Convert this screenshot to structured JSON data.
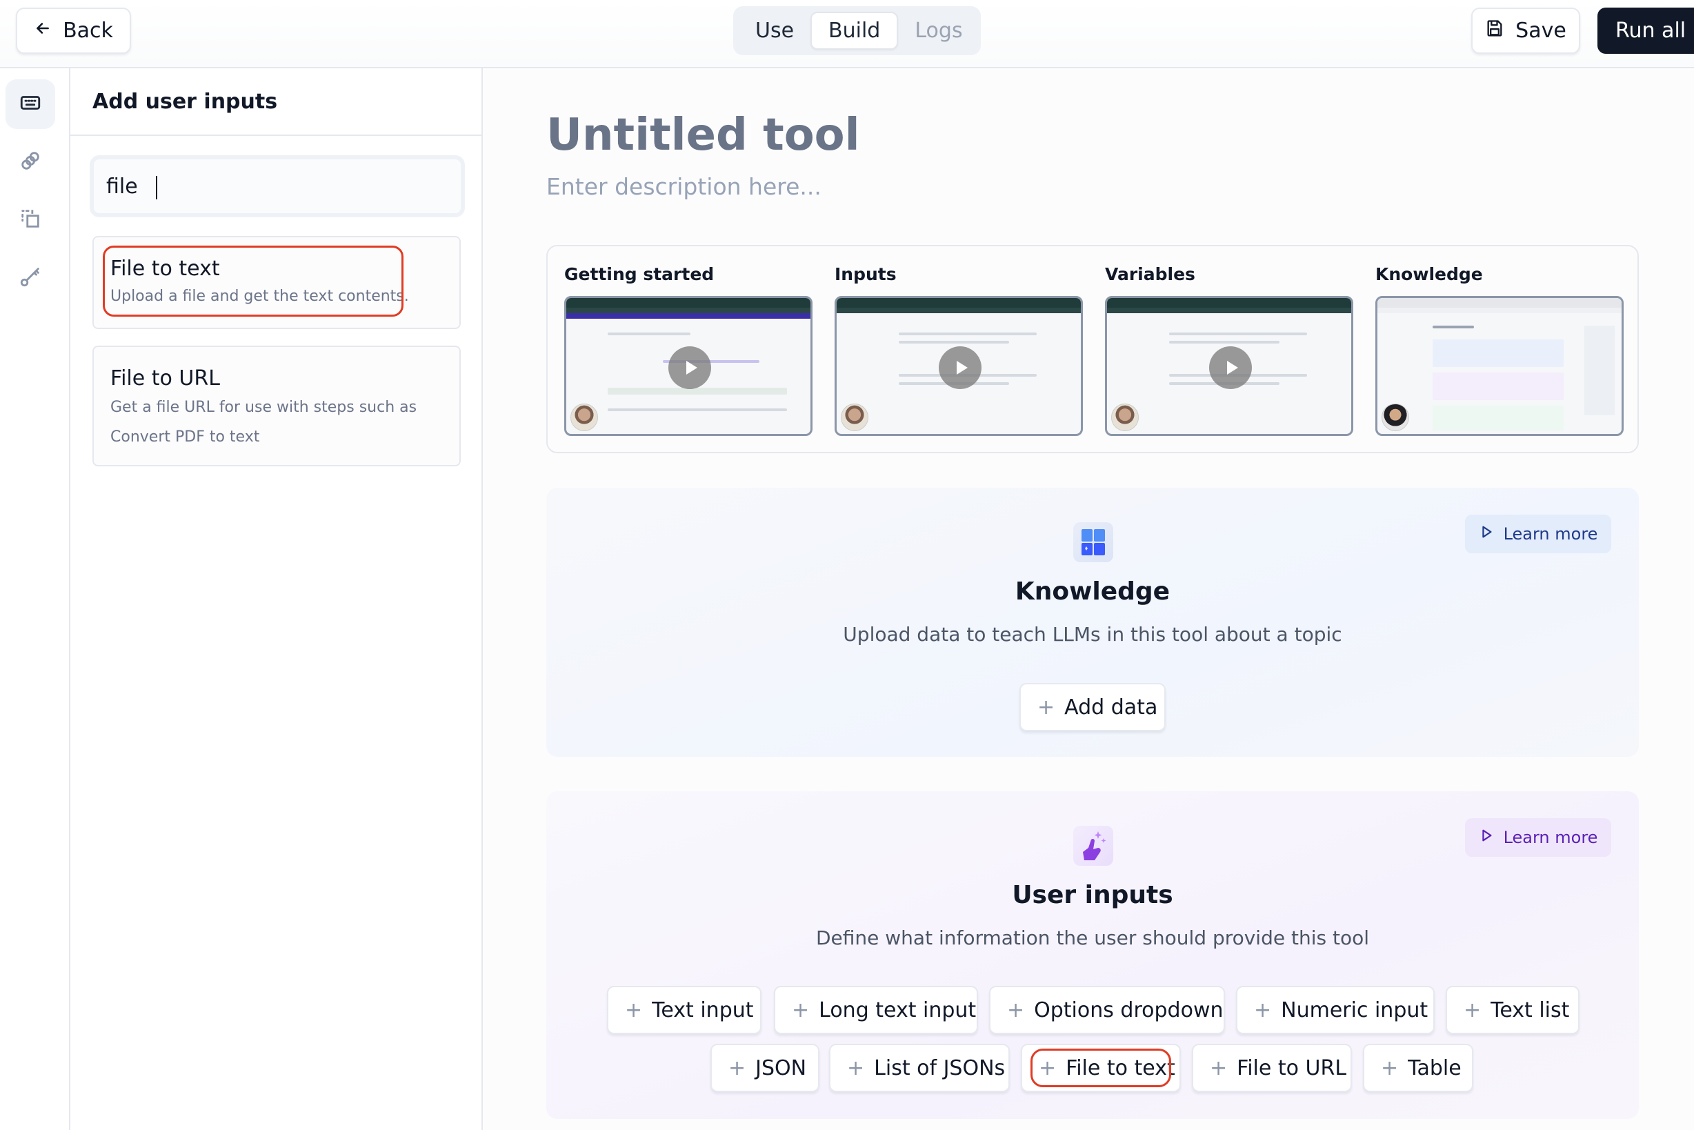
{
  "topbar": {
    "back_label": "Back",
    "tabs": [
      {
        "label": "Use",
        "state": "normal"
      },
      {
        "label": "Build",
        "state": "active"
      },
      {
        "label": "Logs",
        "state": "disabled"
      }
    ],
    "save_label": "Save",
    "run_all_label": "Run all"
  },
  "rail": {
    "items": [
      {
        "icon": "keyboard-icon",
        "active": true
      },
      {
        "icon": "link-icon",
        "active": false
      },
      {
        "icon": "copy-selection-icon",
        "active": false
      },
      {
        "icon": "key-icon",
        "active": false
      }
    ]
  },
  "panel": {
    "title": "Add user inputs",
    "search_value": "file",
    "results": [
      {
        "title": "File to text",
        "description": "Upload a file and get the text contents.",
        "highlighted": true
      },
      {
        "title": "File to URL",
        "description": "Get a file URL for use with steps such as Convert PDF to text",
        "highlighted": false
      }
    ]
  },
  "main": {
    "title": "Untitled tool",
    "description_placeholder": "Enter description here...",
    "tutorials": [
      {
        "label": "Getting started"
      },
      {
        "label": "Inputs"
      },
      {
        "label": "Variables"
      },
      {
        "label": "Knowledge"
      }
    ],
    "knowledge": {
      "title": "Knowledge",
      "subtitle": "Upload data to teach LLMs in this tool about a topic",
      "learn_more": "Learn more",
      "add_button": "Add data",
      "accent": "#3b5bfd"
    },
    "user_inputs": {
      "title": "User inputs",
      "subtitle": "Define what information the user should provide this tool",
      "learn_more": "Learn more",
      "accent": "#8b3fe0",
      "row1": [
        "Text input",
        "Long text input",
        "Options dropdown",
        "Numeric input",
        "Text list"
      ],
      "row2": [
        "JSON",
        "List of JSONs",
        "File to text",
        "File to URL",
        "Table"
      ],
      "highlighted": "File to text"
    }
  },
  "colors": {
    "highlight": "#e03c24",
    "primary_dark": "#111827"
  }
}
